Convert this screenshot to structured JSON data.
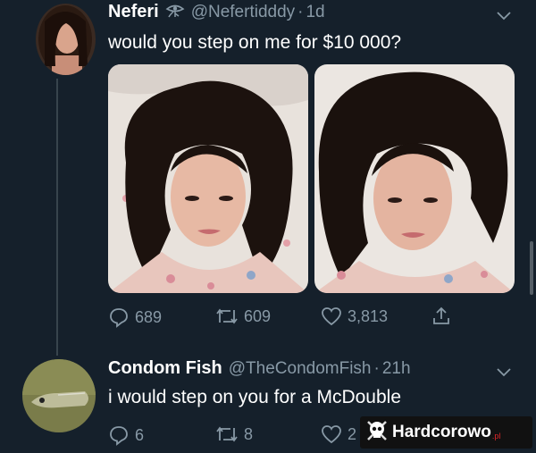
{
  "tweet1": {
    "name": "Neferi",
    "badge_icon": "eye-of-ra-icon",
    "handle": "@Nefertidddy",
    "sep": "·",
    "time": "1d",
    "text": "would you step on me for $10 000?",
    "reply_count": "689",
    "retweet_count": "609",
    "like_count": "3,813"
  },
  "tweet2": {
    "name": "Condom Fish",
    "handle": "@TheCondomFish",
    "sep": "·",
    "time": "21h",
    "text": "i would step on you for a McDouble",
    "reply_count": "6",
    "retweet_count": "8",
    "like_count": "2"
  },
  "watermark": {
    "text": "Hardcorowo",
    "suffix": ".pl"
  },
  "colors": {
    "background": "#15202b",
    "muted": "#8899a6",
    "line": "#38444d"
  }
}
